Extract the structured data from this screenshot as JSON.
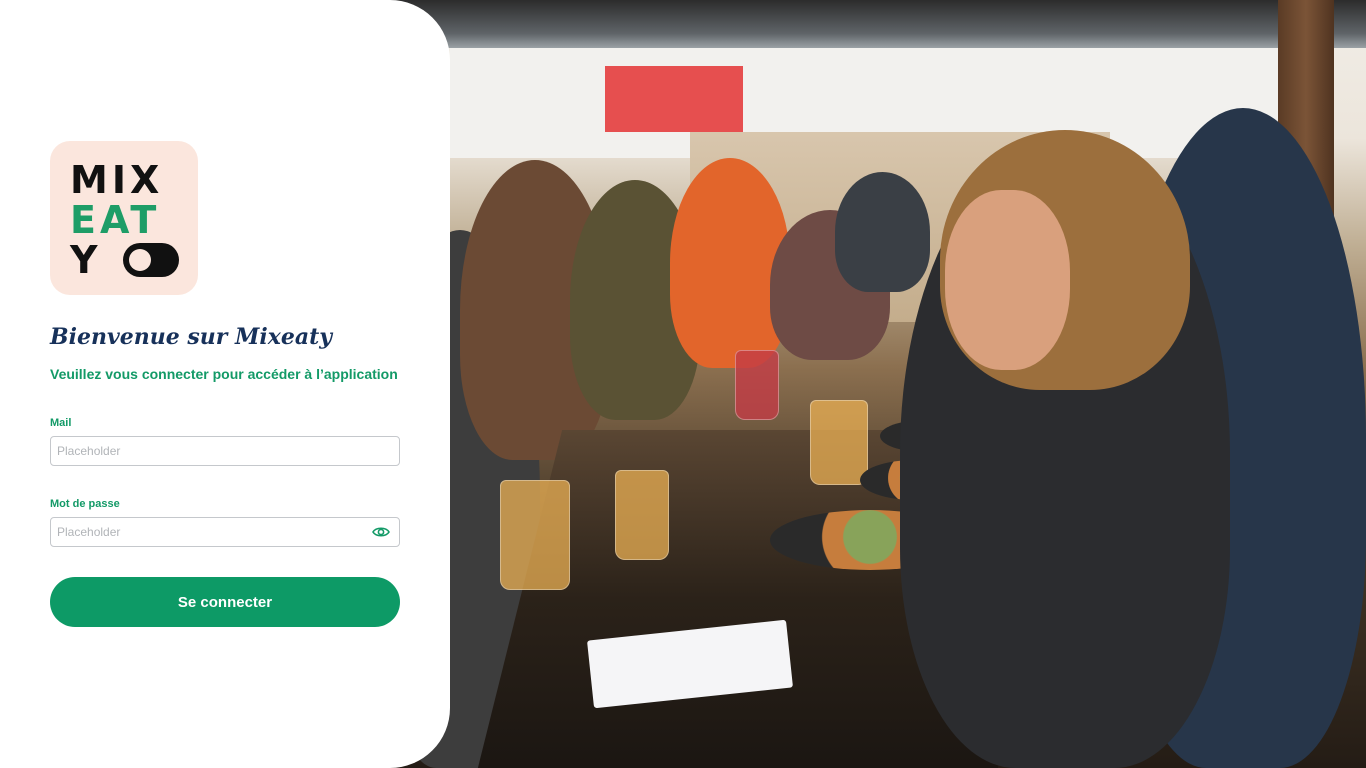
{
  "brand": {
    "logo_lines": [
      "MIX",
      "EAT",
      "Y"
    ],
    "logo_background": "#fbe6dd",
    "logo_accent": "#1e9d67"
  },
  "login": {
    "welcome": "Bienvenue sur Mixeaty",
    "subtitle": "Veuillez vous connecter pour accéder à l’application",
    "mail_label": "Mail",
    "mail_placeholder": "Placeholder",
    "mail_value": "",
    "password_label": "Mot de passe",
    "password_placeholder": "Placeholder",
    "password_value": "",
    "password_toggle_icon": "eye-icon",
    "submit_label": "Se connecter"
  },
  "colors": {
    "primary": "#0d9a66",
    "label_green": "#139a67",
    "heading": "#17315a",
    "input_border": "#c5c8cc"
  },
  "background_image": {
    "subject": "people-dining-at-outdoor-restaurant-table"
  }
}
